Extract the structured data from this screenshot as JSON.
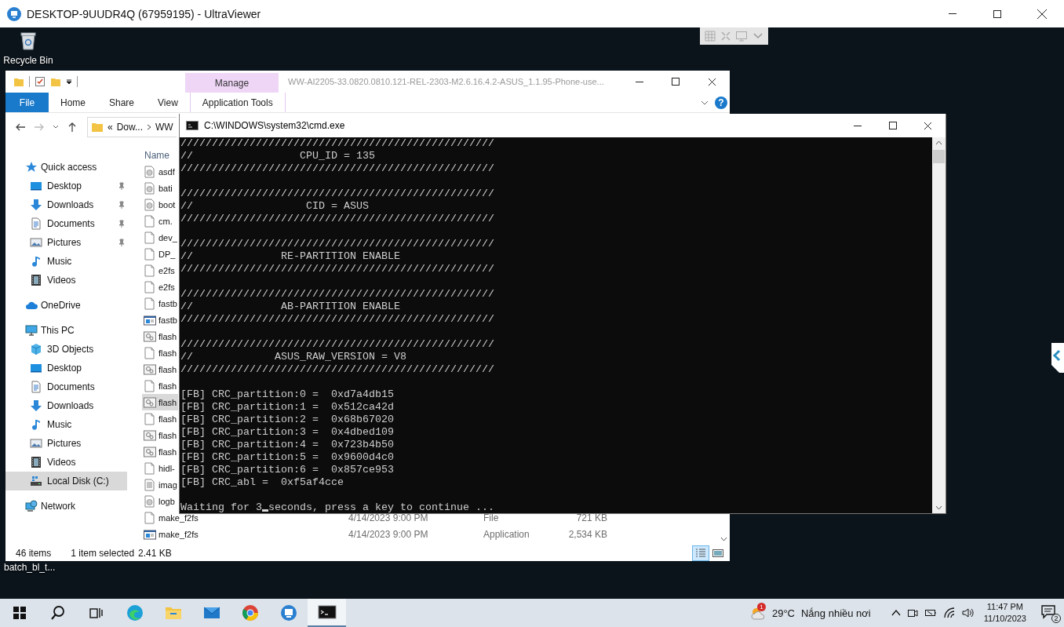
{
  "viewer_window": {
    "title": "DESKTOP-9UUDR4Q (67959195) - UltraViewer"
  },
  "desktop_icons": [
    {
      "label": "Recycle Bin",
      "kind": "recycle-bin"
    },
    {
      "label": "batch_bl_t...",
      "kind": "hidden-icon"
    }
  ],
  "explorer": {
    "title": "WW-AI2205-33.0820.0810.121-REL-2303-M2.6.16.4.2-ASUS_1.1.95-Phone-use...",
    "context_tab": "Manage",
    "ribbon_tabs": [
      {
        "label": "File",
        "selected": true
      },
      {
        "label": "Home",
        "selected": false
      },
      {
        "label": "Share",
        "selected": false
      },
      {
        "label": "View",
        "selected": false
      },
      {
        "label": "Application Tools",
        "selected": false
      }
    ],
    "help": "?",
    "address": {
      "prefix": "«",
      "segments": [
        "Dow...",
        "WW"
      ]
    },
    "nav": [
      {
        "label": "Quick access",
        "kind": "star",
        "selected": false,
        "children": [
          {
            "label": "Desktop",
            "kind": "desktop",
            "pinned": true,
            "selected": false
          },
          {
            "label": "Downloads",
            "kind": "downloads",
            "pinned": true,
            "selected": false
          },
          {
            "label": "Documents",
            "kind": "documents",
            "pinned": true,
            "selected": false
          },
          {
            "label": "Pictures",
            "kind": "pictures",
            "pinned": true,
            "selected": false
          },
          {
            "label": "Music",
            "kind": "music",
            "pinned": false,
            "selected": false
          },
          {
            "label": "Videos",
            "kind": "videos",
            "pinned": false,
            "selected": false
          }
        ]
      },
      {
        "label": "OneDrive",
        "kind": "cloud",
        "selected": false
      },
      {
        "label": "This PC",
        "kind": "pc",
        "selected": false,
        "children": [
          {
            "label": "3D Objects",
            "kind": "cube",
            "selected": false
          },
          {
            "label": "Desktop",
            "kind": "desktop",
            "selected": false
          },
          {
            "label": "Documents",
            "kind": "documents",
            "selected": false
          },
          {
            "label": "Downloads",
            "kind": "downloads",
            "selected": false
          },
          {
            "label": "Music",
            "kind": "music",
            "selected": false
          },
          {
            "label": "Pictures",
            "kind": "pictures",
            "selected": false
          },
          {
            "label": "Videos",
            "kind": "videos",
            "selected": false
          },
          {
            "label": "Local Disk (C:)",
            "kind": "disk",
            "selected": true
          }
        ]
      },
      {
        "label": "Network",
        "kind": "network",
        "selected": false
      }
    ],
    "column": "Name",
    "files": [
      {
        "name": "asdf",
        "kind": "disc",
        "selected": false
      },
      {
        "name": "bati",
        "kind": "disc",
        "selected": false
      },
      {
        "name": "boot",
        "kind": "disc",
        "selected": false
      },
      {
        "name": "cm.",
        "kind": "blank",
        "selected": false
      },
      {
        "name": "dev_",
        "kind": "blank",
        "selected": false
      },
      {
        "name": "DP_",
        "kind": "blank",
        "selected": false
      },
      {
        "name": "e2fs",
        "kind": "blank",
        "selected": false
      },
      {
        "name": "e2fs",
        "kind": "blank",
        "selected": false
      },
      {
        "name": "fastb",
        "kind": "blank",
        "selected": false
      },
      {
        "name": "fastb",
        "kind": "app",
        "selected": false
      },
      {
        "name": "flash",
        "kind": "batch",
        "selected": false
      },
      {
        "name": "flash",
        "kind": "blank",
        "selected": false
      },
      {
        "name": "flash",
        "kind": "batch",
        "selected": false
      },
      {
        "name": "flash",
        "kind": "blank",
        "selected": false
      },
      {
        "name": "flash",
        "kind": "batch",
        "selected": true
      },
      {
        "name": "flash",
        "kind": "blank",
        "selected": false
      },
      {
        "name": "flash",
        "kind": "batch",
        "selected": false
      },
      {
        "name": "flash",
        "kind": "batch",
        "selected": false
      },
      {
        "name": "hidl-",
        "kind": "blank",
        "selected": false
      },
      {
        "name": "imag",
        "kind": "text",
        "selected": false
      },
      {
        "name": "logb",
        "kind": "disc",
        "selected": false
      },
      {
        "name": "make_f2fs",
        "kind": "blank",
        "selected": false,
        "date": "4/14/2023 9:00 PM",
        "type": "File",
        "size": "721 KB"
      },
      {
        "name": "make_f2fs",
        "kind": "app",
        "selected": false,
        "date": "4/14/2023 9:00 PM",
        "type": "Application",
        "size": "2,534 KB"
      }
    ],
    "status": {
      "count": "46 items",
      "selection": "1 item selected",
      "size": "2.41 KB"
    },
    "view_modes": [
      {
        "kind": "details",
        "selected": true
      },
      {
        "kind": "large-icons",
        "selected": false
      }
    ]
  },
  "console": {
    "title": "C:\\WINDOWS\\system32\\cmd.exe",
    "blocks": [
      {
        "lines": [
          "//////////////////////////////////////////////////",
          "//                 CPU_ID = 135",
          "//////////////////////////////////////////////////"
        ]
      },
      {
        "lines": [
          "//////////////////////////////////////////////////",
          "//                  CID = ASUS",
          "//////////////////////////////////////////////////"
        ]
      },
      {
        "lines": [
          "//////////////////////////////////////////////////",
          "//              RE-PARTITION ENABLE",
          "//////////////////////////////////////////////////"
        ]
      },
      {
        "lines": [
          "//////////////////////////////////////////////////",
          "//              AB-PARTITION ENABLE",
          "//////////////////////////////////////////////////"
        ]
      },
      {
        "lines": [
          "//////////////////////////////////////////////////",
          "//             ASUS_RAW_VERSION = V8",
          "//////////////////////////////////////////////////"
        ]
      },
      {
        "lines": [
          "[FB] CRC_partition:0 =  0xd7a4db15",
          "[FB] CRC_partition:1 =  0x512ca42d",
          "[FB] CRC_partition:2 =  0x68b67020",
          "[FB] CRC_partition:3 =  0x4dbed109",
          "[FB] CRC_partition:4 =  0x723b4b50",
          "[FB] CRC_partition:5 =  0x9600d4c0",
          "[FB] CRC_partition:6 =  0x857ce953",
          "[FB] CRC_abl =  0xf5af4cce"
        ]
      }
    ],
    "prompt_before": "Waiting for 3",
    "prompt_after": "seconds, press a key to continue ..."
  },
  "taskbar": {
    "apps": [
      {
        "kind": "edge",
        "active": false
      },
      {
        "kind": "folder",
        "active": false
      },
      {
        "kind": "mail",
        "active": false
      },
      {
        "kind": "chrome",
        "active": false
      },
      {
        "kind": "remote",
        "active": false
      },
      {
        "kind": "console",
        "active": true
      }
    ],
    "weather_badge": "1",
    "temperature": "29°C",
    "weather": "Nắng nhiều nơi",
    "time": "11:47 PM",
    "date": "11/10/2023",
    "notifications": "2"
  }
}
